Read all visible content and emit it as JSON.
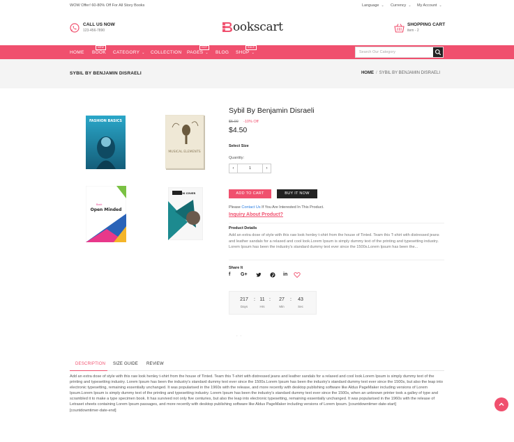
{
  "topbar": {
    "promo": "WOW Offer! 60-80% Off For All Story Books",
    "language": "Language",
    "currency": "Currency",
    "account": "My Account"
  },
  "header": {
    "call_title": "CALL US NOW",
    "call_number": "123-456-7890",
    "logo_text": "ookscart",
    "cart_title": "SHOPPING CART",
    "cart_count": "item - 2"
  },
  "nav": {
    "items": [
      "HOME",
      "BOOK",
      "CATEGORY",
      "COLLECTION",
      "PAGES",
      "BLOG",
      "SHOP"
    ],
    "badges": {
      "book": "NEW",
      "pages": "HOT",
      "shop": "SALE"
    },
    "search_placeholder": "Search Our Category"
  },
  "breadcrumb": {
    "page_title": "SYBIL BY BENJAMIN DISRAELI",
    "home": "HOME",
    "separator": "/",
    "current": "SYBIL BY BENJAMIN DISRAELI"
  },
  "images": [
    {
      "title": "FASHION BASICS"
    },
    {
      "title": "MUSICAL ELEMENTS"
    },
    {
      "title": "Open Minded",
      "top": "Book"
    },
    {
      "title": "BOOK COVER"
    }
  ],
  "product": {
    "name": "Sybil By Benjamin Disraeli",
    "old_price": "$5.00",
    "discount": "-10% Off",
    "price": "$4.50",
    "select_size": "Select Size",
    "quantity_label": "Quantity:",
    "quantity": "1",
    "add_to_cart": "ADD TO CART",
    "buy_it_now": "BUY IT NOW",
    "please_pre": "Please",
    "contact_us": "Contact Us",
    "please_post": "If You Are Interested In This Product.",
    "inquiry": "Inquiry About Product?",
    "details_title": "Product Details",
    "details_text": "Add an extra dose of style with this raw look henley t-shirt from the house of Tinted. Team this T-shirt with distressed jeans and leather sandals for a relaxed and cool look.Lorem Ipsum is simply dummy text of the printing and typesetting industry. Lorem Ipsum has been the industry's standard dummy text ever since the 1500s.Lorem Ipsum has been the...",
    "share_title": "Share It",
    "social_icons": [
      "facebook-icon",
      "google-plus-icon",
      "twitter-icon",
      "pinterest-icon",
      "linkedin-icon",
      "heart-icon"
    ]
  },
  "countdown": {
    "days": "217",
    "hrs": "11",
    "min": "27",
    "sec": "43",
    "days_label": "Days",
    "hrs_label": "Hrs",
    "min_label": "Min",
    "sec_label": "Sec",
    "colon": ":"
  },
  "misc": {
    "dots": ". ."
  },
  "tabs": {
    "items": [
      "DESCRIPTION",
      "SIZE GUIDE",
      "REVIEW"
    ],
    "description": "Add an extra dose of style with this raw look henley t-shirt from the house of Tinted. Team this T-shirt with distressed jeans and leather sandals for a relaxed and cool look.Lorem Ipsum is simply dummy text of the printing and typesetting industry. Lorem Ipsum has been the industry's standard dummy text ever since the 1500s.Lorem Ipsum has been the industry's standard dummy text ever since the 1500s, but also the leap into electronic typesetting, remaining essentially unchanged. It was popularised in the 1960s with the release, and more recently with desktop publishing software like Aldus PageMaker including versions of Lorem Ipsum.Lorem Ipsum is simply dummy text of the printing and typesetting industry. Lorem Ipsum has been the industry's standard dummy text ever since the 1500s, when an unknown printer took a galley of type and scrambled it to make a type specimen book. It has survived not only five centuries, but also the leap into electronic typesetting, remaining essentially unchanged. It was popularised in the 1960s with the release of Letraset sheets containing Lorem Ipsum passages, and more recently with desktop publishing software like Aldus PageMaker including versions of Lorem Ipsum. [countdowntimer-date-start]",
    "description_end": "[countdowntimer-date-end]"
  },
  "colors": {
    "accent": "#f0506e",
    "dark": "#222222",
    "band": "#f4f4f4"
  }
}
